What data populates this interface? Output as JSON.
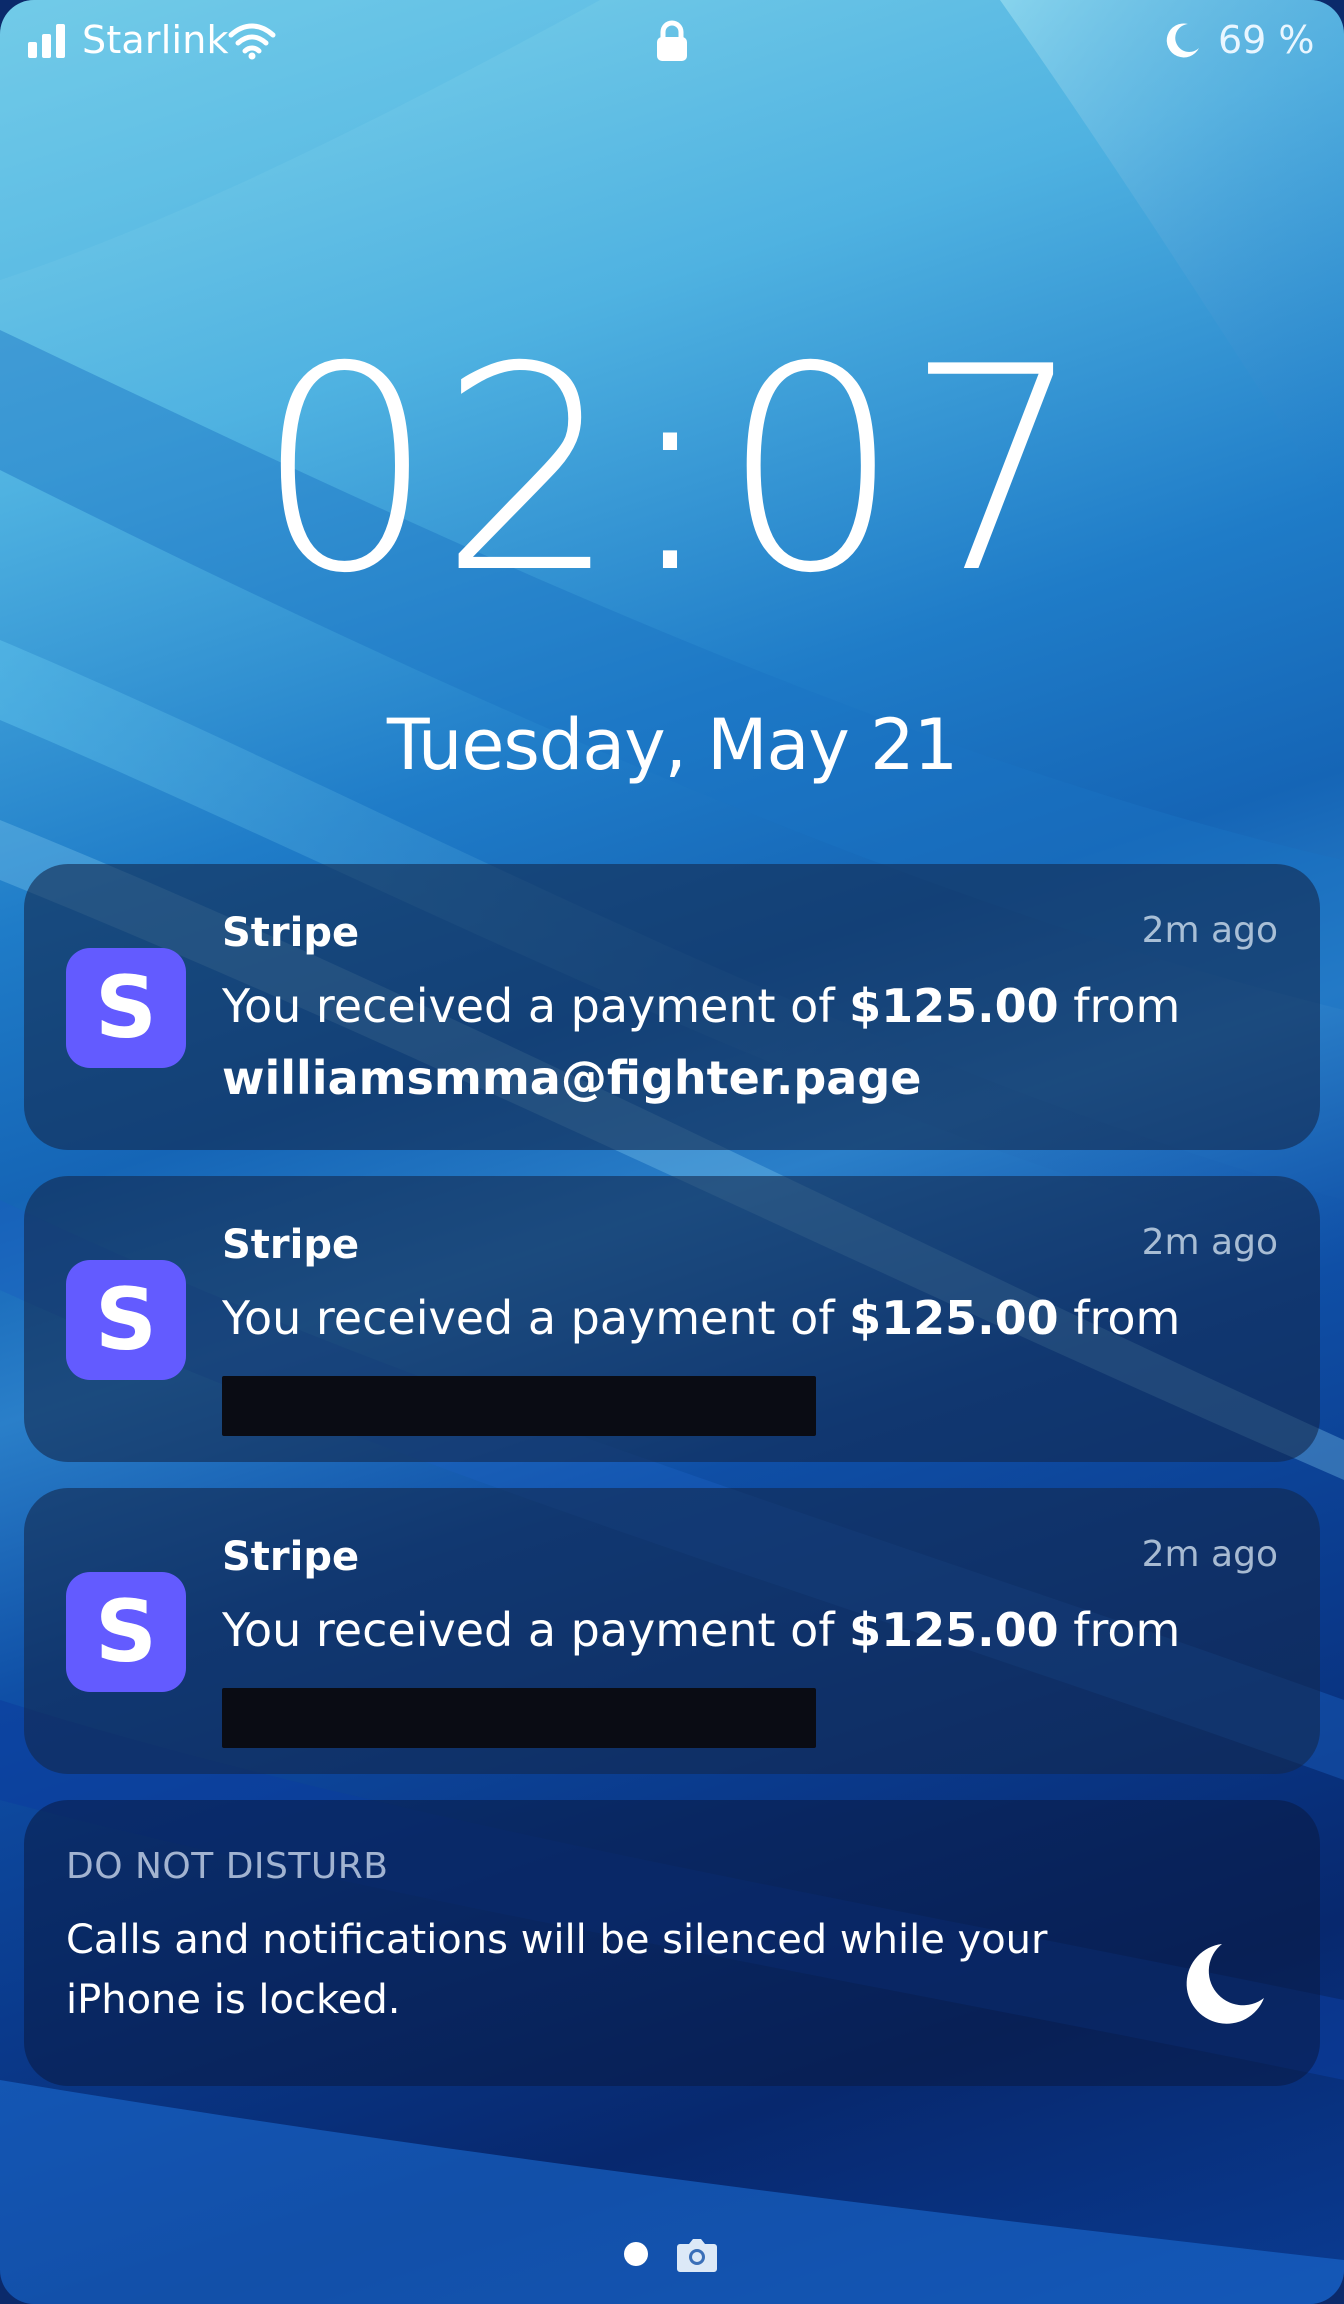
{
  "status_bar": {
    "carrier": "Starlink",
    "battery": "69 %",
    "icons": [
      "signal-bars-icon",
      "wifi-icon",
      "lock-icon",
      "moon-icon"
    ]
  },
  "lock_screen": {
    "time": "02:07",
    "date": "Tuesday, May 21"
  },
  "notifications": [
    {
      "app": "Stripe",
      "icon_letter": "S",
      "icon_color": "#635bff",
      "time": "2m ago",
      "text_prefix": "You received a payment of ",
      "amount": "$125.00",
      "text_suffix": " from",
      "sender": "williamsmma@fighter.page",
      "redacted": false
    },
    {
      "app": "Stripe",
      "icon_letter": "S",
      "icon_color": "#635bff",
      "time": "2m ago",
      "text_prefix": "You received a payment of ",
      "amount": "$125.00",
      "text_suffix": " from",
      "redacted": true
    },
    {
      "app": "Stripe",
      "icon_letter": "S",
      "icon_color": "#635bff",
      "time": "2m ago",
      "text_prefix": "You received a payment of ",
      "amount": "$125.00",
      "text_suffix": " from",
      "redacted": true
    }
  ],
  "dnd": {
    "title": "DO NOT DISTURB",
    "text": "Calls and notifications will be silenced while your iPhone is locked.",
    "icon": "moon-icon"
  },
  "bottom": {
    "icons": [
      "page-indicator-dot",
      "camera-icon"
    ]
  }
}
